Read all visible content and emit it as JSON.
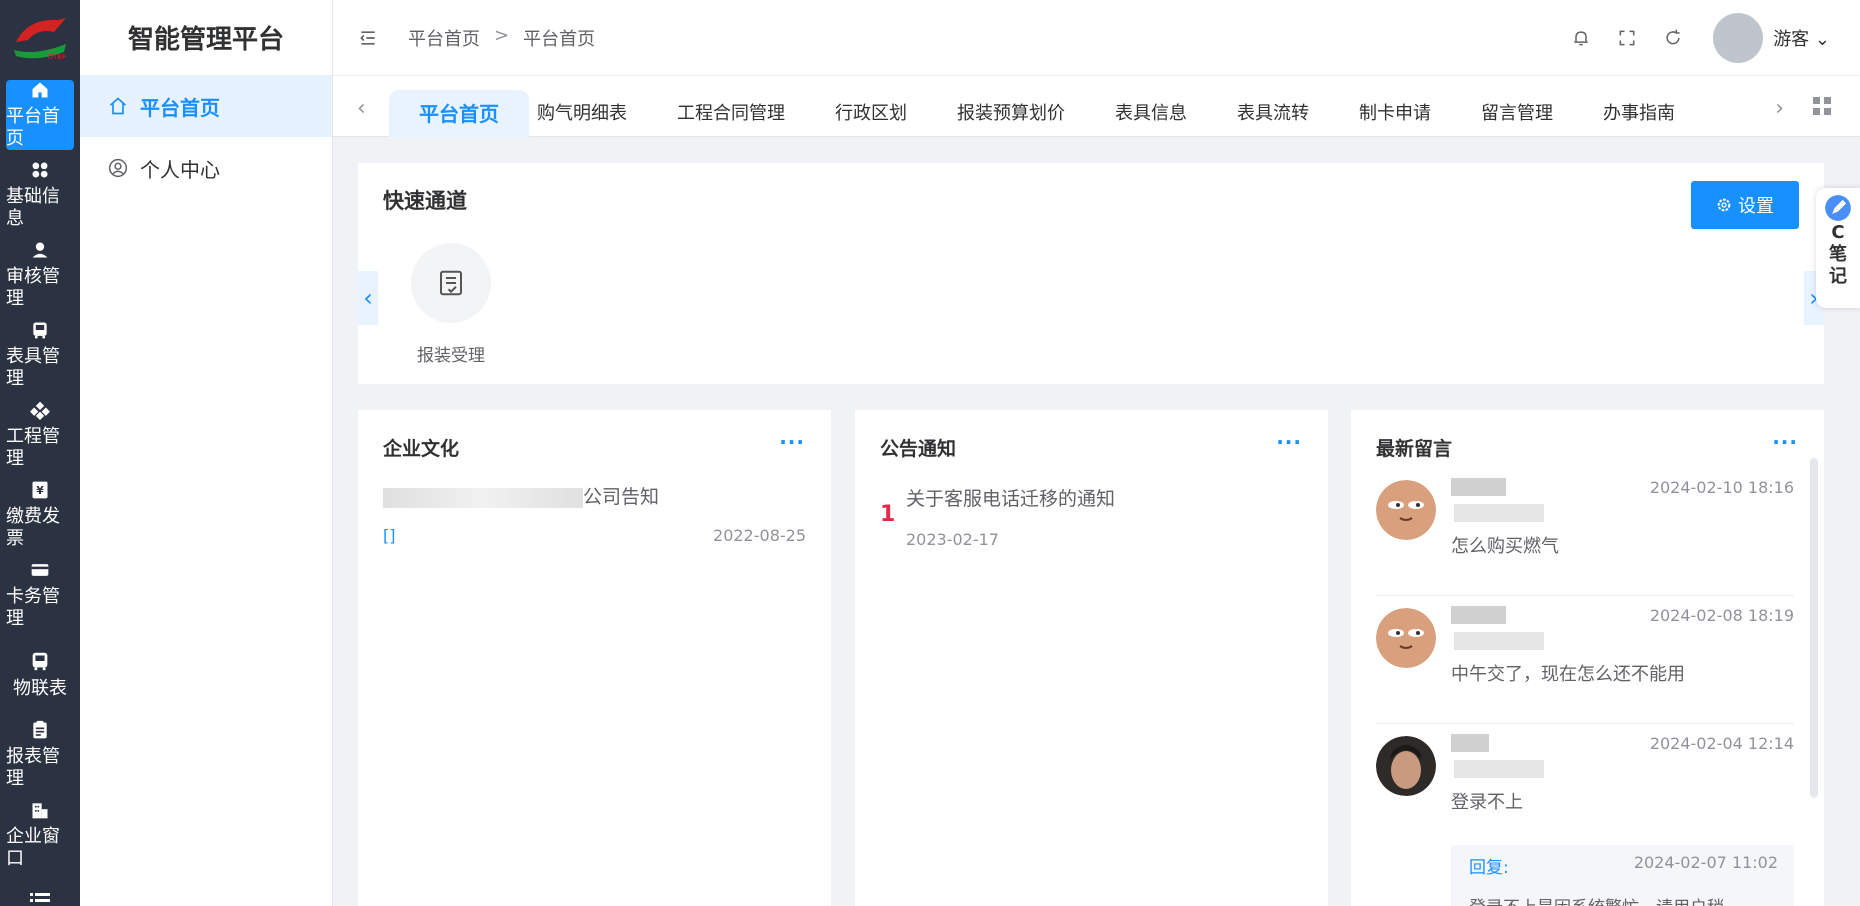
{
  "app": {
    "title": "智能管理平台"
  },
  "rail": {
    "items": [
      {
        "label": "平台首页",
        "icon": "home-icon"
      },
      {
        "label": "基础信息",
        "icon": "apps-icon"
      },
      {
        "label": "审核管理",
        "icon": "user-icon"
      },
      {
        "label": "表具管理",
        "icon": "meter-icon"
      },
      {
        "label": "工程管理",
        "icon": "project-icon"
      },
      {
        "label": "缴费发票",
        "icon": "invoice-icon"
      },
      {
        "label": "卡务管理",
        "icon": "card-icon"
      },
      {
        "label": "物联表",
        "icon": "iot-meter-icon"
      },
      {
        "label": "报表管理",
        "icon": "report-icon"
      },
      {
        "label": "企业窗口",
        "icon": "building-icon"
      }
    ]
  },
  "menu": {
    "items": [
      {
        "label": "平台首页",
        "icon": "home-icon"
      },
      {
        "label": "个人中心",
        "icon": "user-circle-icon"
      }
    ]
  },
  "header": {
    "breadcrumb": [
      "平台首页",
      "平台首页"
    ],
    "separator": ">",
    "user": "游客"
  },
  "tabs": [
    "平台首页",
    "购气明细表",
    "工程合同管理",
    "行政区划",
    "报装预算划价",
    "表具信息",
    "表具流转",
    "制卡申请",
    "留言管理",
    "办事指南"
  ],
  "quick": {
    "title": "快速通道",
    "settings_label": "设置",
    "entries": [
      {
        "label": "报装受理",
        "icon": "form-check-icon"
      }
    ]
  },
  "note_widget": {
    "label": "C笔记"
  },
  "culture": {
    "title": "企业文化",
    "more": "···",
    "item": {
      "title_suffix": "公司告知",
      "bracket": "[]",
      "date": "2022-08-25"
    }
  },
  "notice": {
    "title": "公告通知",
    "more": "···",
    "items": [
      {
        "rank": "1",
        "title": "关于客服电话迁移的通知",
        "date": "2023-02-17"
      }
    ]
  },
  "messages": {
    "title": "最新留言",
    "more": "···",
    "items": [
      {
        "time": "2024-02-10 18:16",
        "content": "怎么购买燃气"
      },
      {
        "time": "2024-02-08 18:19",
        "content": "中午交了，现在怎么还不能用"
      },
      {
        "time": "2024-02-04 12:14",
        "content": "登录不上"
      }
    ],
    "reply": {
      "label": "回复:",
      "time": "2024-02-07 11:02",
      "content": "登录不上是因系统繁忙，请用户稍"
    }
  },
  "colors": {
    "primary": "#1890ff",
    "rail_bg": "#2b3241",
    "rank_red": "#e6284b"
  }
}
